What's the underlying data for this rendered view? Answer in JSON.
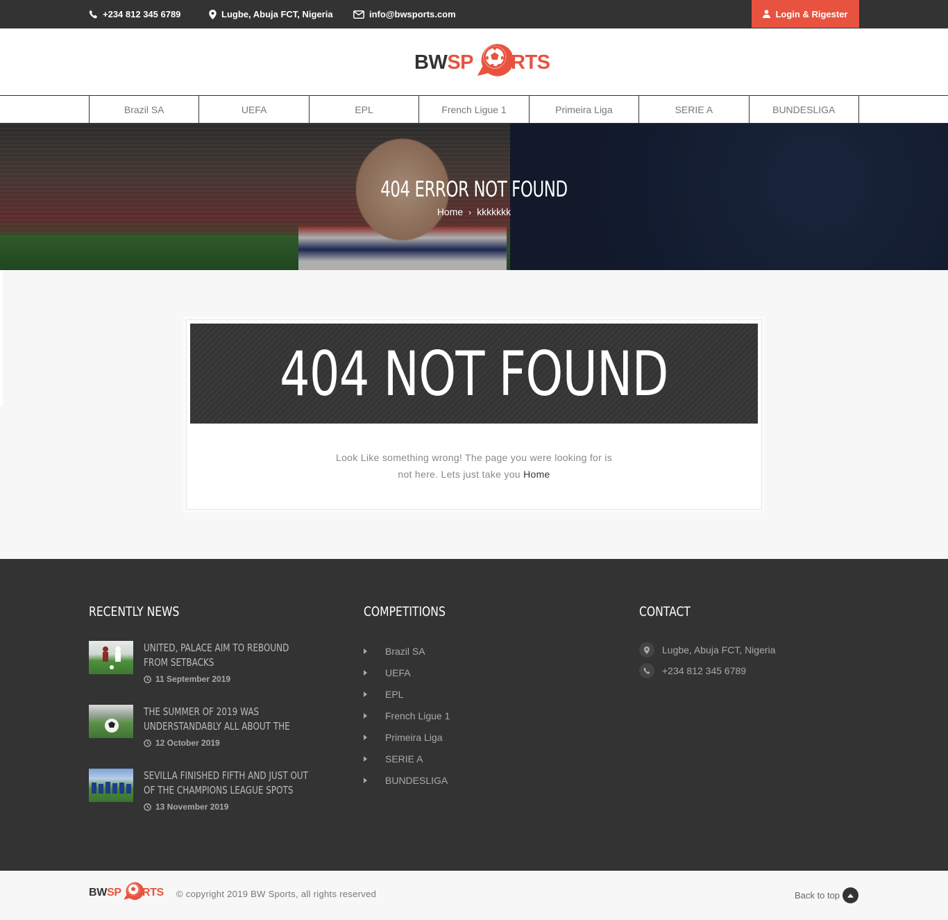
{
  "topbar": {
    "phone": "+234 812 345 6789",
    "address": "Lugbe, Abuja FCT, Nigeria",
    "email": "info@bwsports.com",
    "login_label": "Login & Rigester"
  },
  "logo": {
    "part1": "BW",
    "part2": "SP",
    "part3": "RTS"
  },
  "nav": {
    "items": [
      "Brazil SA",
      "UEFA",
      "EPL",
      "French Ligue 1",
      "Primeira Liga",
      "SERIE A",
      "BUNDESLIGA"
    ]
  },
  "hero": {
    "title": "404 ERROR NOT FOUND",
    "breadcrumb_home": "Home",
    "breadcrumb_current": "kkkkkkk"
  },
  "error": {
    "heading": "404 NOT FOUND",
    "message_line1": "Look Like something wrong! The page you were looking for is",
    "message_line2": "not here. Lets just take you",
    "home_link": "Home"
  },
  "footer": {
    "news_title": "RECENTLY NEWS",
    "competitions_title": "COMPETITIONS",
    "contact_title": "CONTACT",
    "news": [
      {
        "title": "UNITED, PALACE AIM TO REBOUND FROM SETBACKS",
        "date": "11 September 2019"
      },
      {
        "title": "THE SUMMER OF 2019 WAS UNDERSTANDABLY ALL ABOUT THE",
        "date": "12 October 2019"
      },
      {
        "title": "SEVILLA FINISHED FIFTH AND JUST OUT OF THE CHAMPIONS LEAGUE SPOTS",
        "date": "13 November 2019"
      }
    ],
    "competitions": [
      "Brazil SA",
      "UEFA",
      "EPL",
      "French Ligue 1",
      "Primeira Liga",
      "SERIE A",
      "BUNDESLIGA"
    ],
    "contact": {
      "address": "Lugbe, Abuja FCT, Nigeria",
      "phone": "+234 812 345 6789"
    }
  },
  "bottom": {
    "copyright": "© copyright 2019 BW Sports, all rights reserved",
    "back_to_top": "Back to top"
  },
  "colors": {
    "accent": "#e8533f",
    "dark": "#333333"
  }
}
